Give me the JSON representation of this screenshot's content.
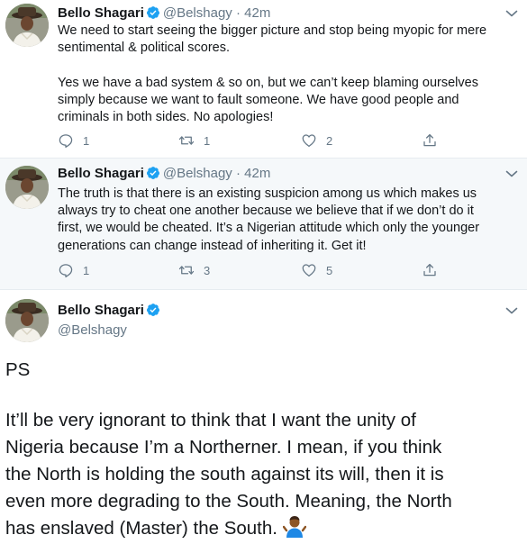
{
  "tweets": [
    {
      "author_name": "Bello Shagari",
      "handle": "@Belshagy",
      "dot": "·",
      "time": "42m",
      "text": "We need to start seeing the bigger picture and stop being myopic for mere\nsentimental & political scores.\n\nYes we have a bad system & so on, but we can’t keep blaming ourselves\nsimply because we want to fault someone. We have good people and\ncriminals in both sides. No apologies!",
      "replies": "1",
      "retweets": "1",
      "likes": "2"
    },
    {
      "author_name": "Bello Shagari",
      "handle": "@Belshagy",
      "dot": "·",
      "time": "42m",
      "text": "The truth is that there is an existing suspicion among us which makes us\nalways try to cheat one another because we believe that if we don’t do it\nfirst, we would be cheated. It’s a Nigerian attitude which only the younger\ngenerations can change instead of inheriting it. Get it!",
      "replies": "1",
      "retweets": "3",
      "likes": "5"
    }
  ],
  "main_tweet": {
    "author_name": "Bello Shagari",
    "handle": "@Belshagy",
    "ps": "PS",
    "body": "It’ll be very ignorant to think that I want the unity of\nNigeria because I’m a Northerner. I mean, if you think\nthe North is holding the south against its will, then it is\neven more degrading to the South. Meaning, the North\nhas enslaved (Master) the South. "
  },
  "colors": {
    "verified": "#1da1f2",
    "text": "#14171a",
    "muted": "#657786",
    "highlight_bg": "#f5f8fa"
  },
  "icons": [
    "verified-badge-icon",
    "chevron-down-icon",
    "reply-icon",
    "retweet-icon",
    "like-icon",
    "share-icon",
    "shrug-emoji-icon"
  ]
}
